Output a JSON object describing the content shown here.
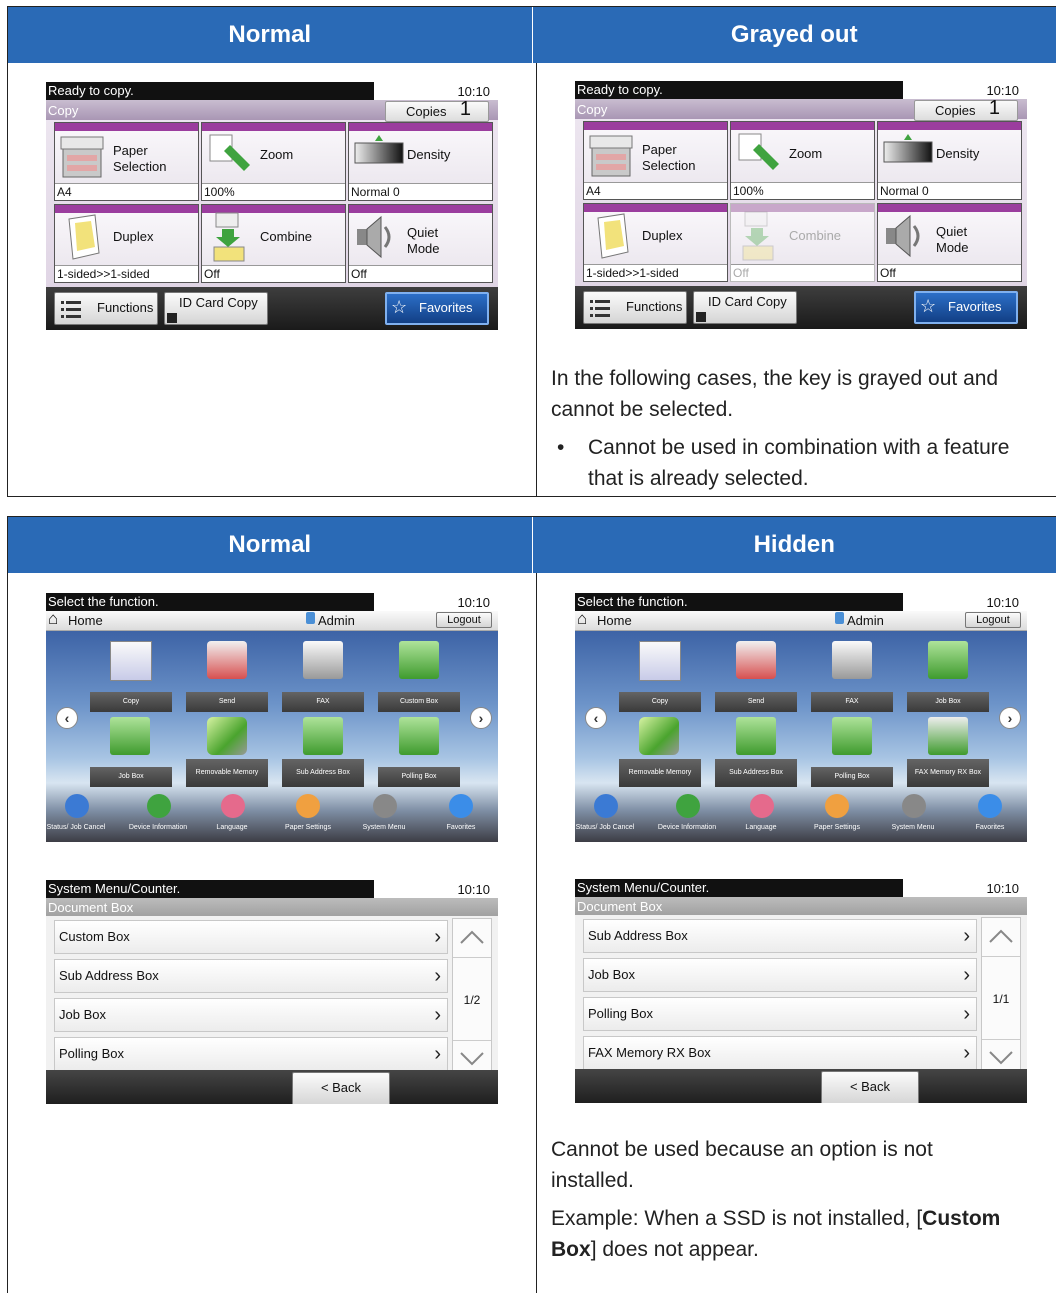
{
  "table1": {
    "header_left": "Normal",
    "header_right": "Grayed out",
    "note_line": "In the following cases, the key is grayed out and cannot be selected.",
    "note_bullet": "Cannot be used in combination with a feature that is already selected.",
    "bullet_char": "•"
  },
  "table2": {
    "header_left": "Normal",
    "header_right": "Hidden",
    "note_line": "Cannot be used because an option is not installed.",
    "note_example_prefix": "Example: When a SSD is not installed, [",
    "note_example_bold": "Custom Box",
    "note_example_suffix": "] does not appear."
  },
  "copy_panel": {
    "status": "Ready to copy.",
    "time": "10:10",
    "title": "Copy",
    "copies_label": "Copies",
    "copies_value": "1",
    "keys": [
      {
        "label": "Paper Selection",
        "value": "A4"
      },
      {
        "label": "Zoom",
        "value": "100%"
      },
      {
        "label": "Density",
        "value": "Normal 0"
      },
      {
        "label": "Duplex",
        "value": "1-sided>>1-sided"
      },
      {
        "label": "Combine",
        "value": "Off"
      },
      {
        "label": "Quiet Mode",
        "value": "Off"
      }
    ],
    "functions": "Functions",
    "id_card": "ID Card Copy",
    "favorites": "Favorites"
  },
  "home_left": {
    "status": "Select the function.",
    "time": "10:10",
    "home": "Home",
    "user": "Admin",
    "logout": "Logout",
    "tiles": [
      "Copy",
      "Send",
      "FAX",
      "Custom Box",
      "Job Box",
      "Removable Memory",
      "Sub Address Box",
      "Polling Box"
    ],
    "bottom": [
      "Status/ Job Cancel",
      "Device Information",
      "Language",
      "Paper Settings",
      "System Menu",
      "Favorites"
    ]
  },
  "home_right": {
    "tiles": [
      "Copy",
      "Send",
      "FAX",
      "Job Box",
      "Removable Memory",
      "Sub Address Box",
      "Polling Box",
      "FAX Memory RX Box"
    ]
  },
  "list_left": {
    "status": "System Menu/Counter.",
    "time": "10:10",
    "title": "Document Box",
    "rows": [
      "Custom Box",
      "Sub Address Box",
      "Job Box",
      "Polling Box"
    ],
    "page": "1/2",
    "back": "< Back"
  },
  "list_right": {
    "rows": [
      "Sub Address Box",
      "Job Box",
      "Polling Box",
      "FAX Memory RX Box"
    ],
    "page": "1/1"
  }
}
